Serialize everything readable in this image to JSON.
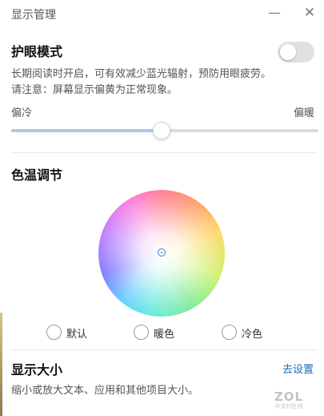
{
  "window": {
    "title": "显示管理",
    "minimize_glyph": "—",
    "close_glyph": "✕"
  },
  "eye_care": {
    "title": "护眼模式",
    "toggle_state": "off",
    "description_line1": "长期阅读时开启，可有效减少蓝光辐射，预防用眼疲劳。",
    "description_line2": "请注意：屏幕显示偏黄为正常现象。"
  },
  "temperature_slider": {
    "left_label": "偏冷",
    "right_label": "偏暖",
    "value_percent": 49
  },
  "color_temp": {
    "title": "色温调节",
    "options": [
      {
        "label": "默认",
        "selected": false
      },
      {
        "label": "暖色",
        "selected": false
      },
      {
        "label": "冷色",
        "selected": false
      }
    ]
  },
  "display_size": {
    "title": "显示大小",
    "link_label": "去设置",
    "description": "缩小或放大文本、应用和其他项目大小。"
  },
  "watermark": {
    "main": "ZOL",
    "sub": "中关村在线"
  },
  "colors": {
    "accent_link": "#1b6bc4",
    "slider_fill": "#a9c8ea",
    "toggle_off": "#e0e0e0"
  }
}
